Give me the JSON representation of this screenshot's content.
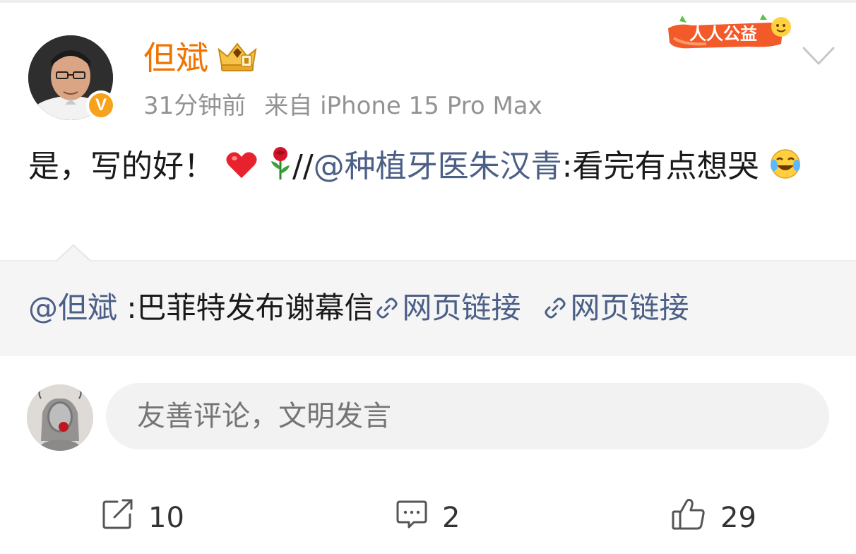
{
  "header": {
    "author": "但斌",
    "time_ago": "31分钟前",
    "source": "来自 iPhone 15 Pro Max",
    "charity_badge": "人人公益",
    "verified_badge": "V"
  },
  "post": {
    "text": "是，写的好！",
    "repost_separator": "//",
    "mention": "@种植牙医朱汉青",
    "quoted_text": ":看完有点想哭",
    "emojis": [
      "heart-emoji",
      "rose-emoji",
      "laugh-cry-emoji"
    ]
  },
  "quote": {
    "mention": "@但斌",
    "text": " :巴菲特发布谢幕信",
    "link1": "网页链接",
    "link2": "网页链接"
  },
  "comment_bar": {
    "placeholder": "友善评论，文明发言"
  },
  "actions": {
    "repost_count": "10",
    "comment_count": "2",
    "like_count": "29"
  },
  "colors": {
    "author": "#f07300",
    "mention": "#4c5f86",
    "meta": "#939393",
    "quote_bg": "#f5f5f6"
  }
}
